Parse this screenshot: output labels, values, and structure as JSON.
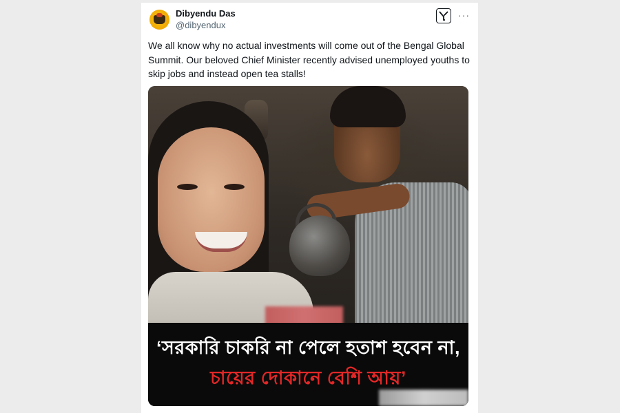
{
  "post": {
    "author_name": "Dibyendu Das",
    "author_handle": "@dibyendux",
    "text": "We all know why no actual investments will come out of the Bengal Global Summit. Our beloved Chief Minister recently advised unemployed youths to skip jobs and instead open tea stalls!",
    "more_label": "···"
  },
  "media": {
    "headline_line1": "‘সরকারি চাকরি না পেলে হতাশ হবেন না,",
    "headline_line2": "চায়ের দোকানে বেশি আয়’"
  },
  "icons": {
    "avatar": "avatar-icon",
    "x_logo": "x-logo-icon",
    "more": "more-options-icon"
  },
  "colors": {
    "headline_white": "#ffffff",
    "headline_red": "#e22727",
    "handle_gray": "#536471",
    "text_dark": "#0f1419"
  }
}
